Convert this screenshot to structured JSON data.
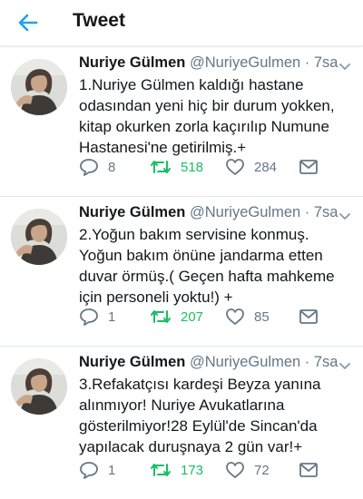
{
  "header": {
    "title": "Tweet"
  },
  "colors": {
    "accent": "#1da1f2",
    "retweet": "#17bf63",
    "muted": "#657786"
  },
  "icons": [
    "back-arrow-icon",
    "reply-icon",
    "retweet-icon",
    "like-icon",
    "dm-icon",
    "chevron-down-icon"
  ],
  "tweets": [
    {
      "name": "Nuriye Gülmen",
      "handle": "@NuriyeGulmen",
      "sep": " · ",
      "time": "7sa",
      "text": "1.Nuriye Gülmen kaldığı hastane odasından yeni hiç bir durum yokken, kitap okurken zorla kaçırılıp Numune Hastanesi'ne getirilmiş.+",
      "replies": "8",
      "retweets": "518",
      "likes": "284"
    },
    {
      "name": "Nuriye Gülmen",
      "handle": "@NuriyeGulmen",
      "sep": " · ",
      "time": "7sa",
      "text": "2.Yoğun bakım servisine konmuş. Yoğun bakım önüne jandarma etten duvar örmüş.( Geçen hafta mahkeme için personeli yoktu!) +",
      "replies": "1",
      "retweets": "207",
      "likes": "85"
    },
    {
      "name": "Nuriye Gülmen",
      "handle": "@NuriyeGulmen",
      "sep": " · ",
      "time": "7sa",
      "text": "3.Refakatçısı kardeşi Beyza yanına alınmıyor! Nuriye Avukatlarına gösterilmiyor!28 Eylül'de Sincan'da yapılacak duruşnaya 2 gün var!+",
      "replies": "1",
      "retweets": "173",
      "likes": "72"
    }
  ]
}
